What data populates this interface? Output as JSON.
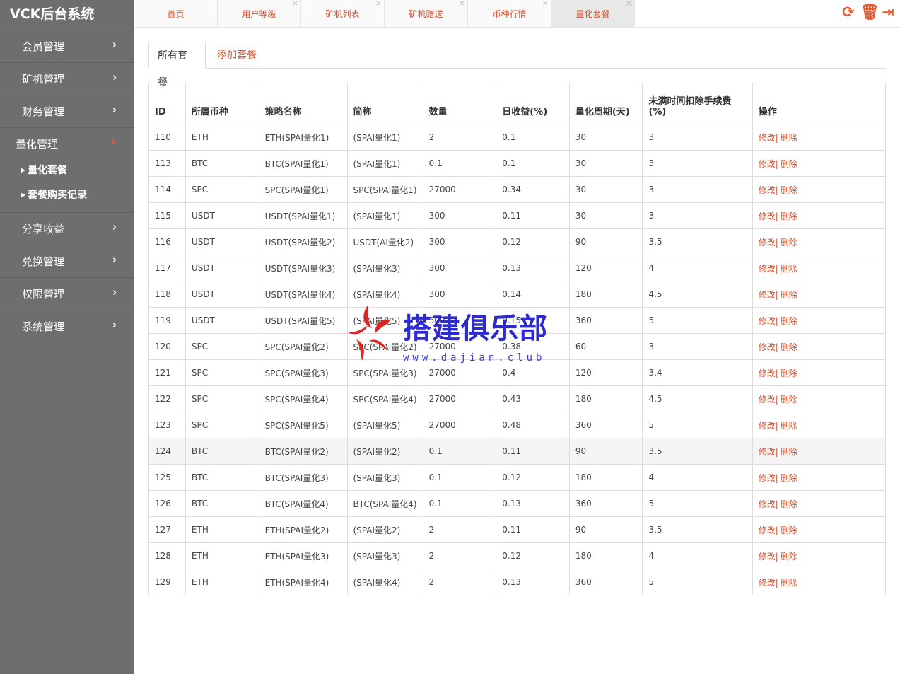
{
  "app": {
    "title": "VCK后台系统"
  },
  "sidebar": {
    "items": [
      {
        "label": "会员管理",
        "open": false
      },
      {
        "label": "矿机管理",
        "open": false
      },
      {
        "label": "财务管理",
        "open": false
      },
      {
        "label": "量化管理",
        "open": true,
        "children": [
          "量化套餐",
          "套餐购买记录"
        ]
      },
      {
        "label": "分享收益",
        "open": false
      },
      {
        "label": "兑换管理",
        "open": false
      },
      {
        "label": "权限管理",
        "open": false
      },
      {
        "label": "系统管理",
        "open": false
      }
    ]
  },
  "tabs": [
    {
      "label": "首页",
      "closable": false,
      "active": false
    },
    {
      "label": "用户等级",
      "closable": true,
      "active": false
    },
    {
      "label": "矿机列表",
      "closable": true,
      "active": false
    },
    {
      "label": "矿机赠送",
      "closable": true,
      "active": false
    },
    {
      "label": "币种行情",
      "closable": true,
      "active": false
    },
    {
      "label": "量化套餐",
      "closable": true,
      "active": true
    }
  ],
  "tools": [
    "refresh-icon",
    "trash-icon",
    "logout-icon"
  ],
  "subtabs": {
    "all": "所有套餐",
    "add": "添加套餐"
  },
  "table": {
    "headers": [
      "ID",
      "所属币种",
      "策略名称",
      "简称",
      "数量",
      "日收益(%)",
      "量化周期(天)",
      "未满时间扣除手续费(%)",
      "操作"
    ],
    "rows": [
      [
        "110",
        "ETH",
        "ETH(SPAI量化1)",
        "(SPAI量化1)",
        "2",
        "0.1",
        "30",
        "3"
      ],
      [
        "113",
        "BTC",
        "BTC(SPAI量化1)",
        "(SPAI量化1)",
        "0.1",
        "0.1",
        "30",
        "3"
      ],
      [
        "114",
        "SPC",
        "SPC(SPAI量化1)",
        "SPC(SPAI量化1)",
        "27000",
        "0.34",
        "30",
        "3"
      ],
      [
        "115",
        "USDT",
        "USDT(SPAI量化1)",
        "(SPAI量化1)",
        "300",
        "0.11",
        "30",
        "3"
      ],
      [
        "116",
        "USDT",
        "USDT(SPAI量化2)",
        "USDT(AI量化2)",
        "300",
        "0.12",
        "90",
        "3.5"
      ],
      [
        "117",
        "USDT",
        "USDT(SPAI量化3)",
        "(SPAI量化3)",
        "300",
        "0.13",
        "120",
        "4"
      ],
      [
        "118",
        "USDT",
        "USDT(SPAI量化4)",
        "(SPAI量化4)",
        "300",
        "0.14",
        "180",
        "4.5"
      ],
      [
        "119",
        "USDT",
        "USDT(SPAI量化5)",
        "(SPAI量化5)",
        "300",
        "0.15",
        "360",
        "5"
      ],
      [
        "120",
        "SPC",
        "SPC(SPAI量化2)",
        "SPC(SPAI量化2)",
        "27000",
        "0.38",
        "60",
        "3"
      ],
      [
        "121",
        "SPC",
        "SPC(SPAI量化3)",
        "SPC(SPAI量化3)",
        "27000",
        "0.4",
        "120",
        "3.4"
      ],
      [
        "122",
        "SPC",
        "SPC(SPAI量化4)",
        "SPC(SPAI量化4)",
        "27000",
        "0.43",
        "180",
        "4.5"
      ],
      [
        "123",
        "SPC",
        "SPC(SPAI量化5)",
        "(SPAI量化5)",
        "27000",
        "0.48",
        "360",
        "5"
      ],
      [
        "124",
        "BTC",
        "BTC(SPAI量化2)",
        "(SPAI量化2)",
        "0.1",
        "0.11",
        "90",
        "3.5"
      ],
      [
        "125",
        "BTC",
        "BTC(SPAI量化3)",
        "(SPAI量化3)",
        "0.1",
        "0.12",
        "180",
        "4"
      ],
      [
        "126",
        "BTC",
        "BTC(SPAI量化4)",
        "BTC(SPAI量化4)",
        "0.1",
        "0.13",
        "360",
        "5"
      ],
      [
        "127",
        "ETH",
        "ETH(SPAI量化2)",
        "(SPAI量化2)",
        "2",
        "0.11",
        "90",
        "3.5"
      ],
      [
        "128",
        "ETH",
        "ETH(SPAI量化3)",
        "(SPAI量化3)",
        "2",
        "0.12",
        "180",
        "4"
      ],
      [
        "129",
        "ETH",
        "ETH(SPAI量化4)",
        "(SPAI量化4)",
        "2",
        "0.13",
        "360",
        "5"
      ]
    ],
    "highlight_row_id": "124",
    "actions": {
      "edit": "修改",
      "sep": "|",
      "delete": "删除"
    }
  },
  "watermark": {
    "text": "搭建俱乐部",
    "url": "www.dajian.club"
  },
  "colors": {
    "accent": "#d2502f",
    "sidebar": "#6e6e6e",
    "watermark": "#2d2ad0"
  }
}
